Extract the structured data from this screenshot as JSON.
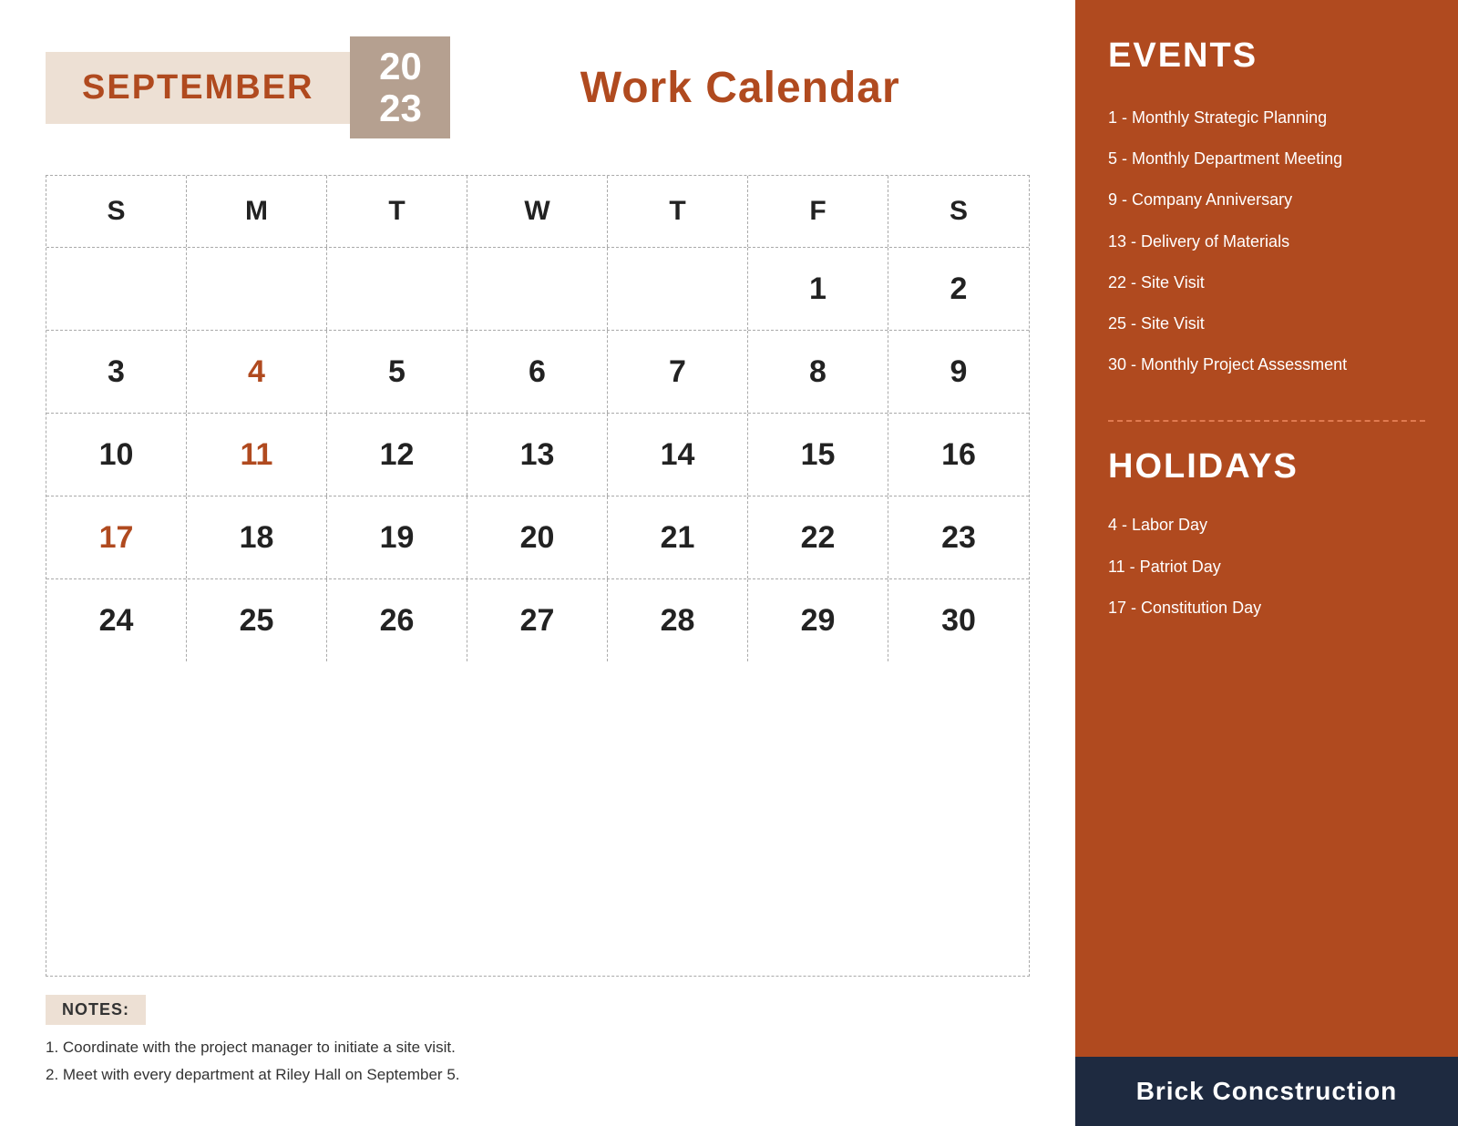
{
  "header": {
    "month": "SEPTEMBER",
    "year_line1": "20",
    "year_line2": "23",
    "title": "Work Calendar"
  },
  "calendar": {
    "day_headers": [
      "S",
      "M",
      "T",
      "W",
      "T",
      "F",
      "S"
    ],
    "weeks": [
      [
        {
          "day": "",
          "empty": true,
          "highlight": false,
          "sunday": false
        },
        {
          "day": "",
          "empty": true,
          "highlight": false,
          "sunday": false
        },
        {
          "day": "",
          "empty": true,
          "highlight": false,
          "sunday": false
        },
        {
          "day": "",
          "empty": true,
          "highlight": false,
          "sunday": false
        },
        {
          "day": "",
          "empty": true,
          "highlight": false,
          "sunday": false
        },
        {
          "day": "1",
          "empty": false,
          "highlight": false,
          "sunday": false
        },
        {
          "day": "2",
          "empty": false,
          "highlight": false,
          "sunday": false
        }
      ],
      [
        {
          "day": "3",
          "empty": false,
          "highlight": false,
          "sunday": false
        },
        {
          "day": "4",
          "empty": false,
          "highlight": true,
          "sunday": false
        },
        {
          "day": "5",
          "empty": false,
          "highlight": false,
          "sunday": false
        },
        {
          "day": "6",
          "empty": false,
          "highlight": false,
          "sunday": false
        },
        {
          "day": "7",
          "empty": false,
          "highlight": false,
          "sunday": false
        },
        {
          "day": "8",
          "empty": false,
          "highlight": false,
          "sunday": false
        },
        {
          "day": "9",
          "empty": false,
          "highlight": false,
          "sunday": false
        }
      ],
      [
        {
          "day": "10",
          "empty": false,
          "highlight": false,
          "sunday": false
        },
        {
          "day": "11",
          "empty": false,
          "highlight": true,
          "sunday": false
        },
        {
          "day": "12",
          "empty": false,
          "highlight": false,
          "sunday": false
        },
        {
          "day": "13",
          "empty": false,
          "highlight": false,
          "sunday": false
        },
        {
          "day": "14",
          "empty": false,
          "highlight": false,
          "sunday": false
        },
        {
          "day": "15",
          "empty": false,
          "highlight": false,
          "sunday": false
        },
        {
          "day": "16",
          "empty": false,
          "highlight": false,
          "sunday": false
        }
      ],
      [
        {
          "day": "17",
          "empty": false,
          "highlight": false,
          "sunday": true
        },
        {
          "day": "18",
          "empty": false,
          "highlight": false,
          "sunday": false
        },
        {
          "day": "19",
          "empty": false,
          "highlight": false,
          "sunday": false
        },
        {
          "day": "20",
          "empty": false,
          "highlight": false,
          "sunday": false
        },
        {
          "day": "21",
          "empty": false,
          "highlight": false,
          "sunday": false
        },
        {
          "day": "22",
          "empty": false,
          "highlight": false,
          "sunday": false
        },
        {
          "day": "23",
          "empty": false,
          "highlight": false,
          "sunday": false
        }
      ],
      [
        {
          "day": "24",
          "empty": false,
          "highlight": false,
          "sunday": false
        },
        {
          "day": "25",
          "empty": false,
          "highlight": false,
          "sunday": false
        },
        {
          "day": "26",
          "empty": false,
          "highlight": false,
          "sunday": false
        },
        {
          "day": "27",
          "empty": false,
          "highlight": false,
          "sunday": false
        },
        {
          "day": "28",
          "empty": false,
          "highlight": false,
          "sunday": false
        },
        {
          "day": "29",
          "empty": false,
          "highlight": false,
          "sunday": false
        },
        {
          "day": "30",
          "empty": false,
          "highlight": false,
          "sunday": false
        }
      ]
    ]
  },
  "notes": {
    "label": "NOTES:",
    "items": [
      "1. Coordinate with the project manager to initiate a site visit.",
      "2. Meet with every department at Riley Hall on September 5."
    ]
  },
  "events": {
    "title": "EVENTS",
    "items": [
      "1 - Monthly Strategic Planning",
      "5 - Monthly Department Meeting",
      "9 - Company Anniversary",
      "13 - Delivery of Materials",
      "22 - Site Visit",
      "25 - Site Visit",
      "30 - Monthly Project Assessment"
    ]
  },
  "holidays": {
    "title": "HOLIDAYS",
    "items": [
      "4 - Labor Day",
      "11 - Patriot Day",
      "17 - Constitution Day"
    ]
  },
  "company": {
    "name": "Brick Concstruction"
  }
}
